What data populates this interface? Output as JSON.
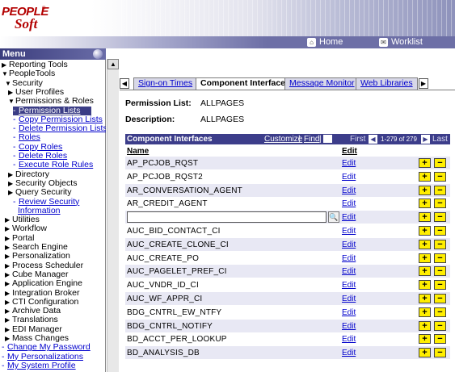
{
  "brand": {
    "line1": "PEOPLE",
    "line2": "Soft"
  },
  "navbar": {
    "home": "Home",
    "worklist": "Worklist"
  },
  "menu": {
    "title": "Menu",
    "items": [
      {
        "label": "Reporting Tools",
        "kind": "collapsed"
      },
      {
        "label": "PeopleTools",
        "kind": "expanded"
      },
      {
        "label": "Security",
        "kind": "expanded"
      },
      {
        "label": "User Profiles",
        "kind": "collapsed"
      },
      {
        "label": "Permissions & Roles",
        "kind": "expanded"
      },
      {
        "label": "Permission Lists",
        "kind": "selected"
      },
      {
        "label": "Copy Permission Lists",
        "kind": "link"
      },
      {
        "label": "Delete Permission Lists",
        "kind": "link"
      },
      {
        "label": "Roles",
        "kind": "link"
      },
      {
        "label": "Copy Roles",
        "kind": "link"
      },
      {
        "label": "Delete Roles",
        "kind": "link"
      },
      {
        "label": "Execute Role Rules",
        "kind": "link"
      },
      {
        "label": "Directory",
        "kind": "collapsed"
      },
      {
        "label": "Security Objects",
        "kind": "collapsed"
      },
      {
        "label": "Query Security",
        "kind": "collapsed"
      },
      {
        "label": "Review Security",
        "kind": "link"
      },
      {
        "label": "Information",
        "kind": "linkcont"
      },
      {
        "label": "Utilities",
        "kind": "collapsed"
      },
      {
        "label": "Workflow",
        "kind": "collapsed"
      },
      {
        "label": "Portal",
        "kind": "collapsed"
      },
      {
        "label": "Search Engine",
        "kind": "collapsed"
      },
      {
        "label": "Personalization",
        "kind": "collapsed"
      },
      {
        "label": "Process Scheduler",
        "kind": "collapsed"
      },
      {
        "label": "Cube Manager",
        "kind": "collapsed"
      },
      {
        "label": "Application Engine",
        "kind": "collapsed"
      },
      {
        "label": "Integration Broker",
        "kind": "collapsed"
      },
      {
        "label": "CTI Configuration",
        "kind": "collapsed"
      },
      {
        "label": "Archive Data",
        "kind": "collapsed"
      },
      {
        "label": "Translations",
        "kind": "collapsed"
      },
      {
        "label": "EDI Manager",
        "kind": "collapsed"
      },
      {
        "label": "Mass Changes",
        "kind": "collapsed"
      },
      {
        "label": "Change My Password",
        "kind": "toplink"
      },
      {
        "label": "My Personalizations",
        "kind": "toplink"
      },
      {
        "label": "My System Profile",
        "kind": "toplink"
      }
    ]
  },
  "tabs": {
    "t1": "Sign-on Times",
    "t2": "Component Interfaces",
    "t3": "Message Monitor",
    "t4": "Web Libraries"
  },
  "form": {
    "permission_label": "Permission List:",
    "permission_value": "ALLPAGES",
    "description_label": "Description:",
    "description_value": "ALLPAGES"
  },
  "grid": {
    "title": "Component Interfaces",
    "customize": "Customize",
    "find": "Find",
    "first": "First",
    "range": "1-279 of 279",
    "last": "Last",
    "col_name": "Name",
    "col_edit": "Edit",
    "edit_label": "Edit",
    "rows": [
      "AP_PCJOB_RQST",
      "AP_PCJOB_RQST2",
      "AR_CONVERSATION_AGENT",
      "AR_CREDIT_AGENT",
      "",
      "AUC_BID_CONTACT_CI",
      "AUC_CREATE_CLONE_CI",
      "AUC_CREATE_PO",
      "AUC_PAGELET_PREF_CI",
      "AUC_VNDR_ID_CI",
      "AUC_WF_APPR_CI",
      "BDG_CNTRL_EW_NTFY",
      "BDG_CNTRL_NOTIFY",
      "BD_ACCT_PER_LOOKUP",
      "BD_ANALYSIS_DB"
    ]
  }
}
